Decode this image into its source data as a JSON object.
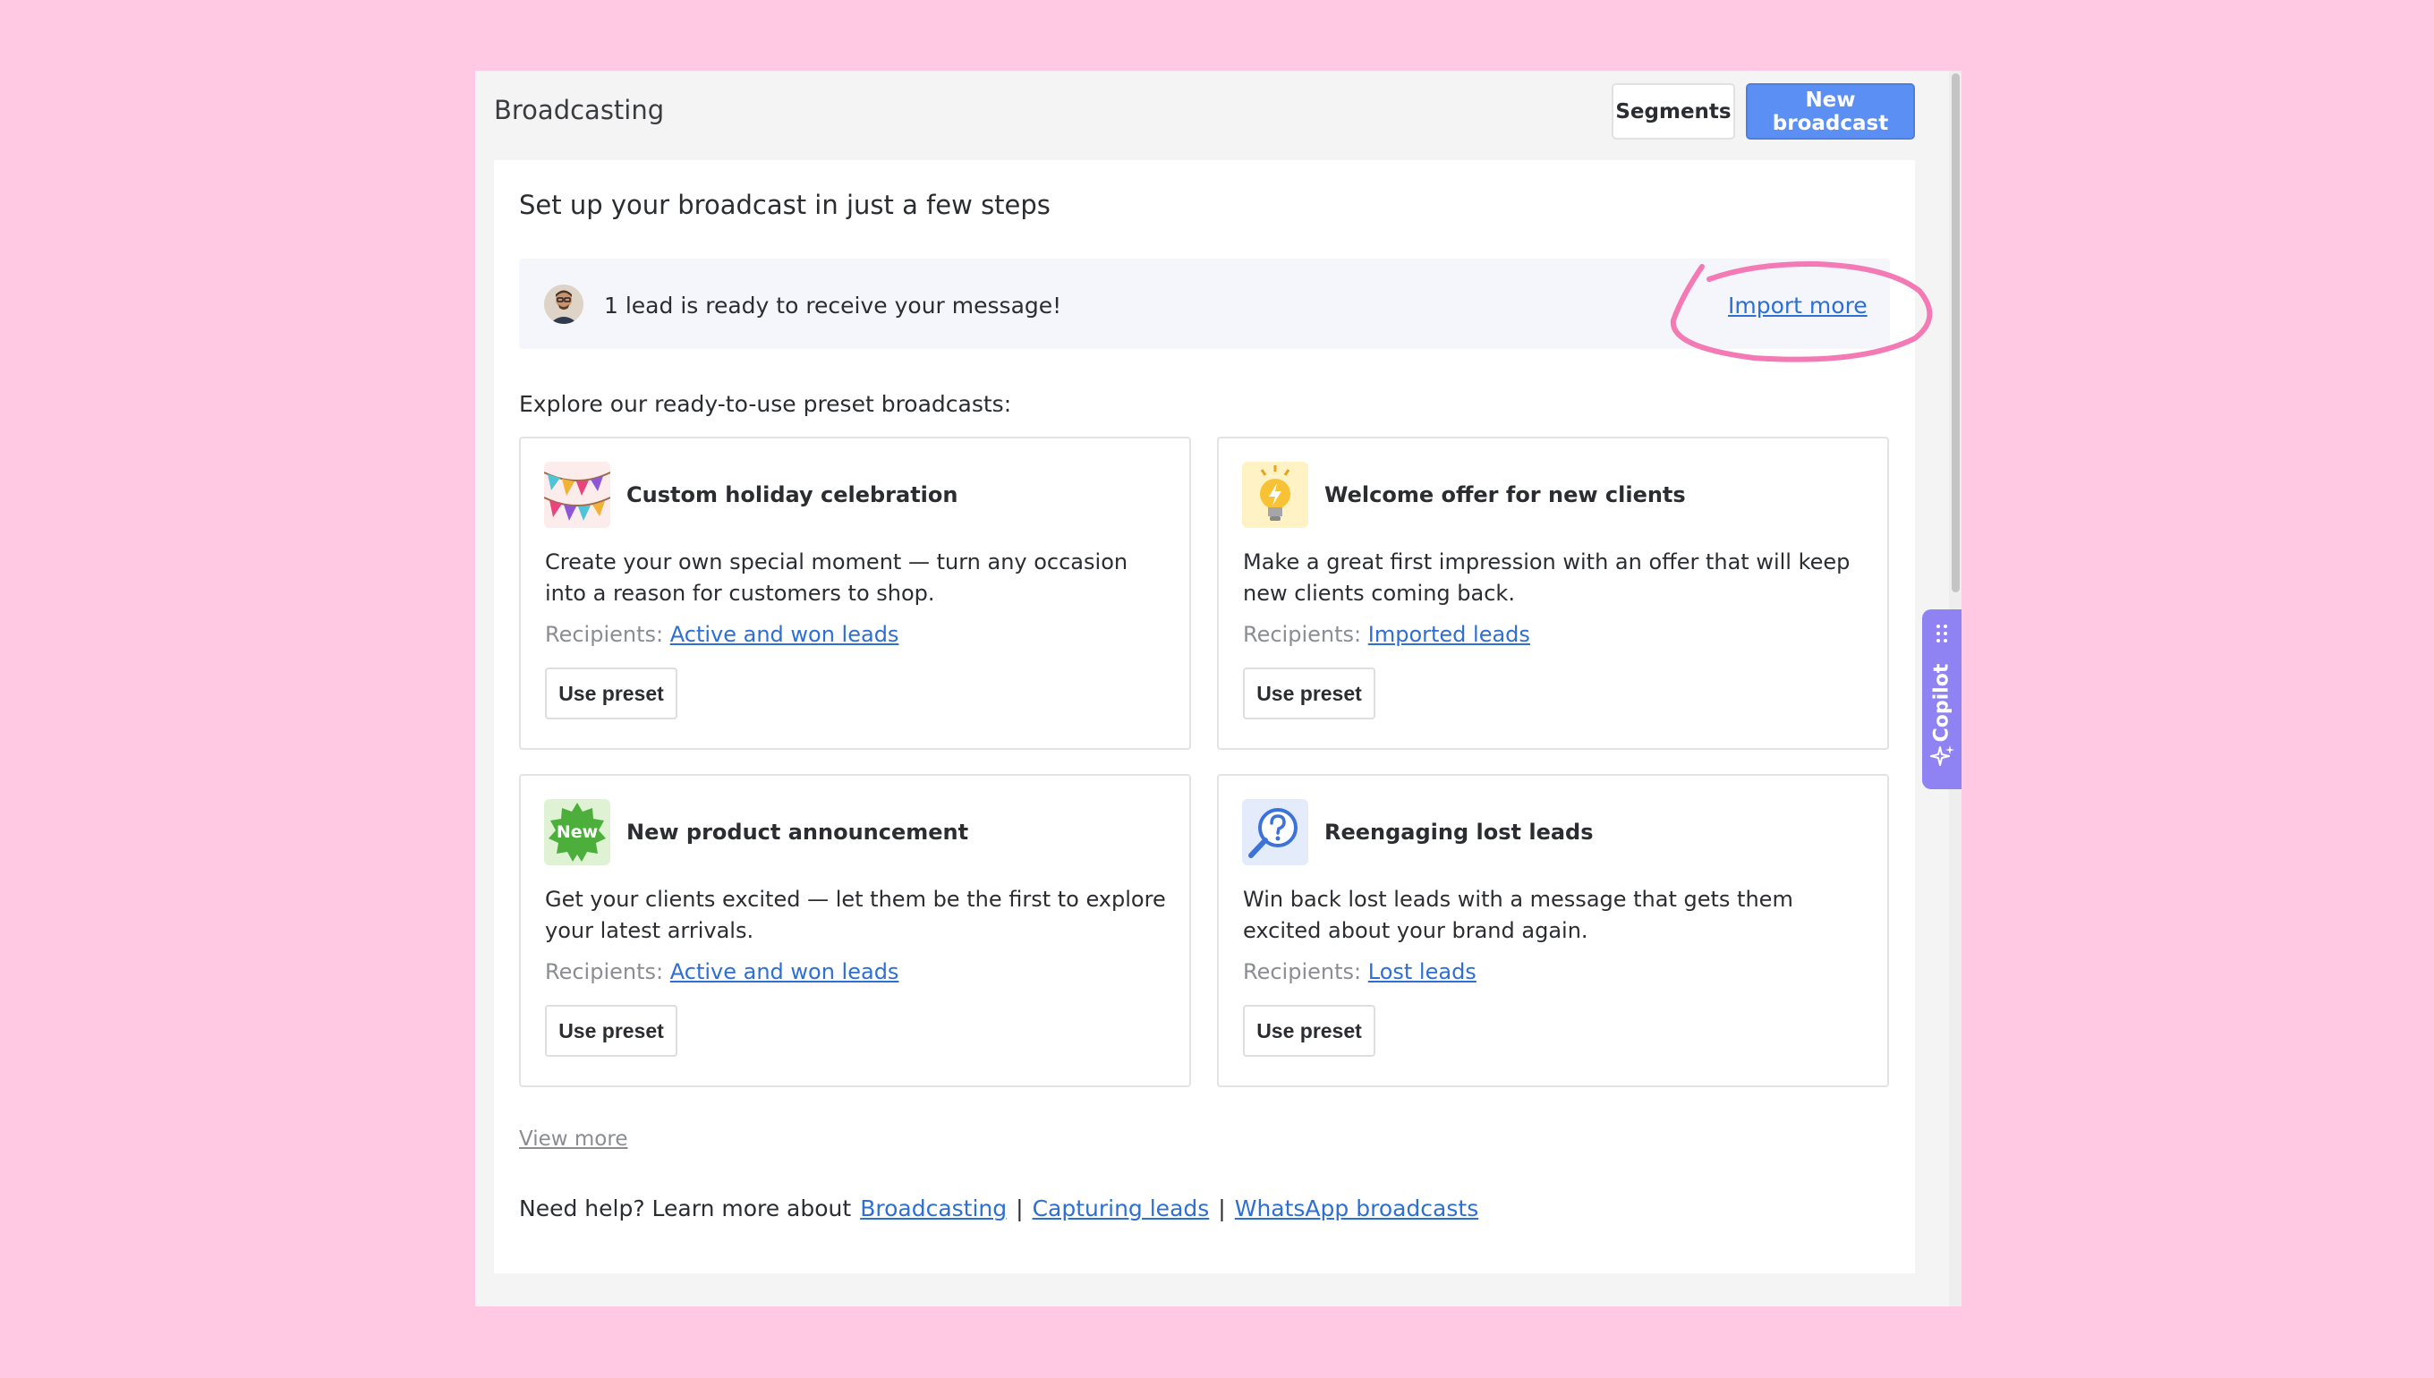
{
  "header": {
    "title": "Broadcasting",
    "segments_label": "Segments",
    "new_broadcast_label": "New broadcast"
  },
  "setup": {
    "title": "Set up your broadcast in just a few steps"
  },
  "banner": {
    "message": "1 lead is ready to receive your message!",
    "import_label": "Import more"
  },
  "presets": {
    "heading": "Explore our ready-to-use preset broadcasts:",
    "recipients_prefix": "Recipients:",
    "use_label": "Use preset",
    "items": [
      {
        "title": "Custom holiday celebration",
        "description": "Create your own special moment — turn any occasion into a reason for customers to shop.",
        "recipients": "Active and won leads",
        "icon": "bunting-flags-icon"
      },
      {
        "title": "Welcome offer for new clients",
        "description": "Make a great first impression with an offer that will keep new clients coming back.",
        "recipients": "Imported leads",
        "icon": "lightbulb-icon"
      },
      {
        "title": "New product announcement",
        "description": "Get your clients excited — let them be the first to explore your latest arrivals.",
        "recipients": "Active and won leads",
        "icon": "new-badge-icon",
        "badge_text": "New"
      },
      {
        "title": "Reengaging lost leads",
        "description": "Win back lost leads with a message that gets them excited about your brand again.",
        "recipients": "Lost leads",
        "icon": "magnifier-question-icon"
      }
    ]
  },
  "view_more_label": "View more",
  "help": {
    "prefix": "Need help? Learn more about",
    "separator": "|",
    "links": [
      "Broadcasting",
      "Capturing leads",
      "WhatsApp broadcasts"
    ]
  },
  "copilot": {
    "label": "Copilot"
  },
  "colors": {
    "background": "#ffc8e3",
    "primary": "#5b8ff3",
    "link": "#2d6fd2",
    "annotation": "#f47ab5",
    "copilot": "#8f83f3"
  }
}
